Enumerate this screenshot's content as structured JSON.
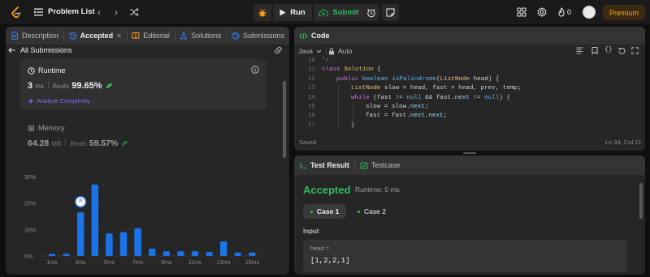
{
  "topbar": {
    "title": "Problem List",
    "prev_arrow": "‹",
    "next_arrow": "›",
    "run_label": "Run",
    "submit_label": "Submit",
    "streak_count": "0",
    "premium_label": "Premium",
    "icons": [
      "leetcode-logo-icon",
      "list-icon",
      "shuffle-icon",
      "debug-icon",
      "play-icon",
      "upload-icon",
      "alarm-icon",
      "note-icon",
      "grid-icon",
      "gear-icon",
      "fire-icon"
    ]
  },
  "left_panel": {
    "tabs": [
      {
        "label": "Description"
      },
      {
        "label": "Accepted",
        "close": "✕"
      },
      {
        "label": "Editorial"
      },
      {
        "label": "Solutions"
      },
      {
        "label": "Submissions"
      }
    ],
    "back_label": "All Submissions",
    "runtime": {
      "title": "Runtime",
      "value": "3",
      "unit": "ms",
      "beats_label": "Beats",
      "beats_pct": "99.65%",
      "analyze_label": "Analyze Complexity"
    },
    "memory": {
      "title": "Memory",
      "value": "64.28",
      "unit": "MB",
      "beats_label": "Beats",
      "beats_pct": "59.57%"
    }
  },
  "chart_data": {
    "type": "bar",
    "y_ticks": [
      "30%",
      "20%",
      "10%",
      "0%"
    ],
    "x_tick_labels": [
      "1ms",
      "3ms",
      "5ms",
      "7ms",
      "9ms",
      "11ms",
      "13ms",
      "15ms"
    ],
    "ylim": [
      0,
      30
    ],
    "values": [
      0.8,
      0.8,
      16.5,
      27,
      8.5,
      9,
      10.5,
      2.8,
      1.8,
      1.8,
      1.8,
      1.5,
      5.5,
      1.3,
      1.3
    ],
    "highlight_index": 2,
    "bar_color": "#1a73e8"
  },
  "code_panel": {
    "title": "Code",
    "language": "Java",
    "mode": "Auto",
    "status": "Saved",
    "cursor": "Ln 34, Col 21",
    "lines": [
      {
        "n": "10",
        "text": "*/"
      },
      {
        "n": "11",
        "text": "class Solution {"
      },
      {
        "n": "12",
        "text": "public boolean isPalindrome(ListNode head) {"
      },
      {
        "n": "13",
        "text": "ListNode slow = head, fast = head, prev, temp;"
      },
      {
        "n": "14",
        "text": "while (fast != null && fast.next != null) {"
      },
      {
        "n": "15",
        "text": "slow = slow.next;"
      },
      {
        "n": "16",
        "text": "fast = fast.next.next;"
      },
      {
        "n": "17",
        "text": "}"
      }
    ]
  },
  "test_panel": {
    "tab_result": "Test Result",
    "tab_testcase": "Testcase",
    "status": "Accepted",
    "runtime": "Runtime: 0 ms",
    "cases": [
      "Case 1",
      "Case 2"
    ],
    "input_label": "Input",
    "param_name": "head =",
    "param_value": "[1,2,2,1]"
  },
  "colors": {
    "accent_green": "#2cbb5d",
    "premium_orange": "#ffa116",
    "bar_blue": "#1a73e8"
  }
}
